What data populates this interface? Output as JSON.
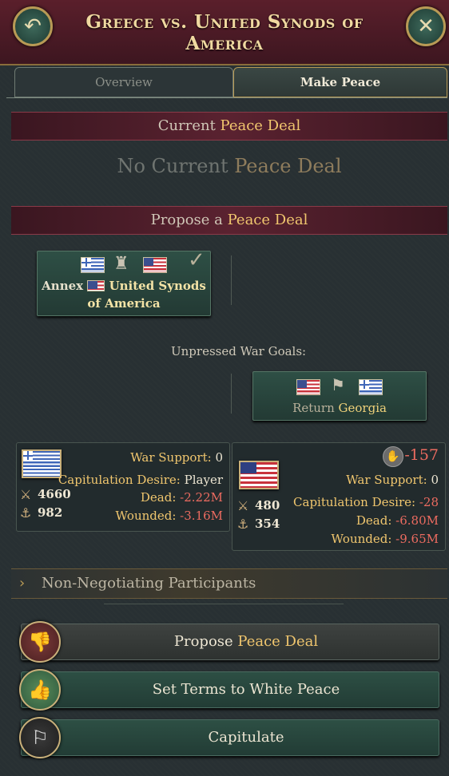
{
  "header": {
    "title": "Greece vs. United Synods of America",
    "back_icon": "↶",
    "close_icon": "✕"
  },
  "tabs": [
    {
      "label": "Overview",
      "active": false
    },
    {
      "label": "Make Peace",
      "active": true
    }
  ],
  "current_deal": {
    "band_prefix": "Current ",
    "band_highlight": "Peace Deal",
    "empty_prefix": "No Current ",
    "empty_highlight": "Peace Deal"
  },
  "propose_section": {
    "band_prefix": "Propose a ",
    "band_highlight": "Peace Deal"
  },
  "war_goal_primary": {
    "check_icon": "✓",
    "action": "Annex",
    "target_line1": "United Synods",
    "target_line2": "of America"
  },
  "unpressed": {
    "label": "Unpressed War Goals:",
    "goal_action": "Return ",
    "goal_target": "Georgia"
  },
  "left_side": {
    "war_support_label": "War Support: ",
    "war_support_value": "0",
    "cap_label": "Capitulation Desire: ",
    "cap_value": "Player",
    "dead_label": "Dead: ",
    "dead_value": "-2.22M",
    "wounded_label": "Wounded: ",
    "wounded_value": "-3.16M",
    "army_value": "4660",
    "navy_value": "982"
  },
  "right_side": {
    "score_value": "-157",
    "war_support_label": "War Support: ",
    "war_support_value": "0",
    "cap_label": "Capitulation Desire: ",
    "cap_value": "-28",
    "dead_label": "Dead: ",
    "dead_value": "-6.80M",
    "wounded_label": "Wounded: ",
    "wounded_value": "-9.65M",
    "army_value": "480",
    "navy_value": "354"
  },
  "non_negotiating": {
    "label": "Non-Negotiating Participants"
  },
  "actions": {
    "propose_prefix": "Propose ",
    "propose_highlight": "Peace Deal",
    "white_peace": "Set Terms to White Peace",
    "capitulate": "Capitulate"
  }
}
